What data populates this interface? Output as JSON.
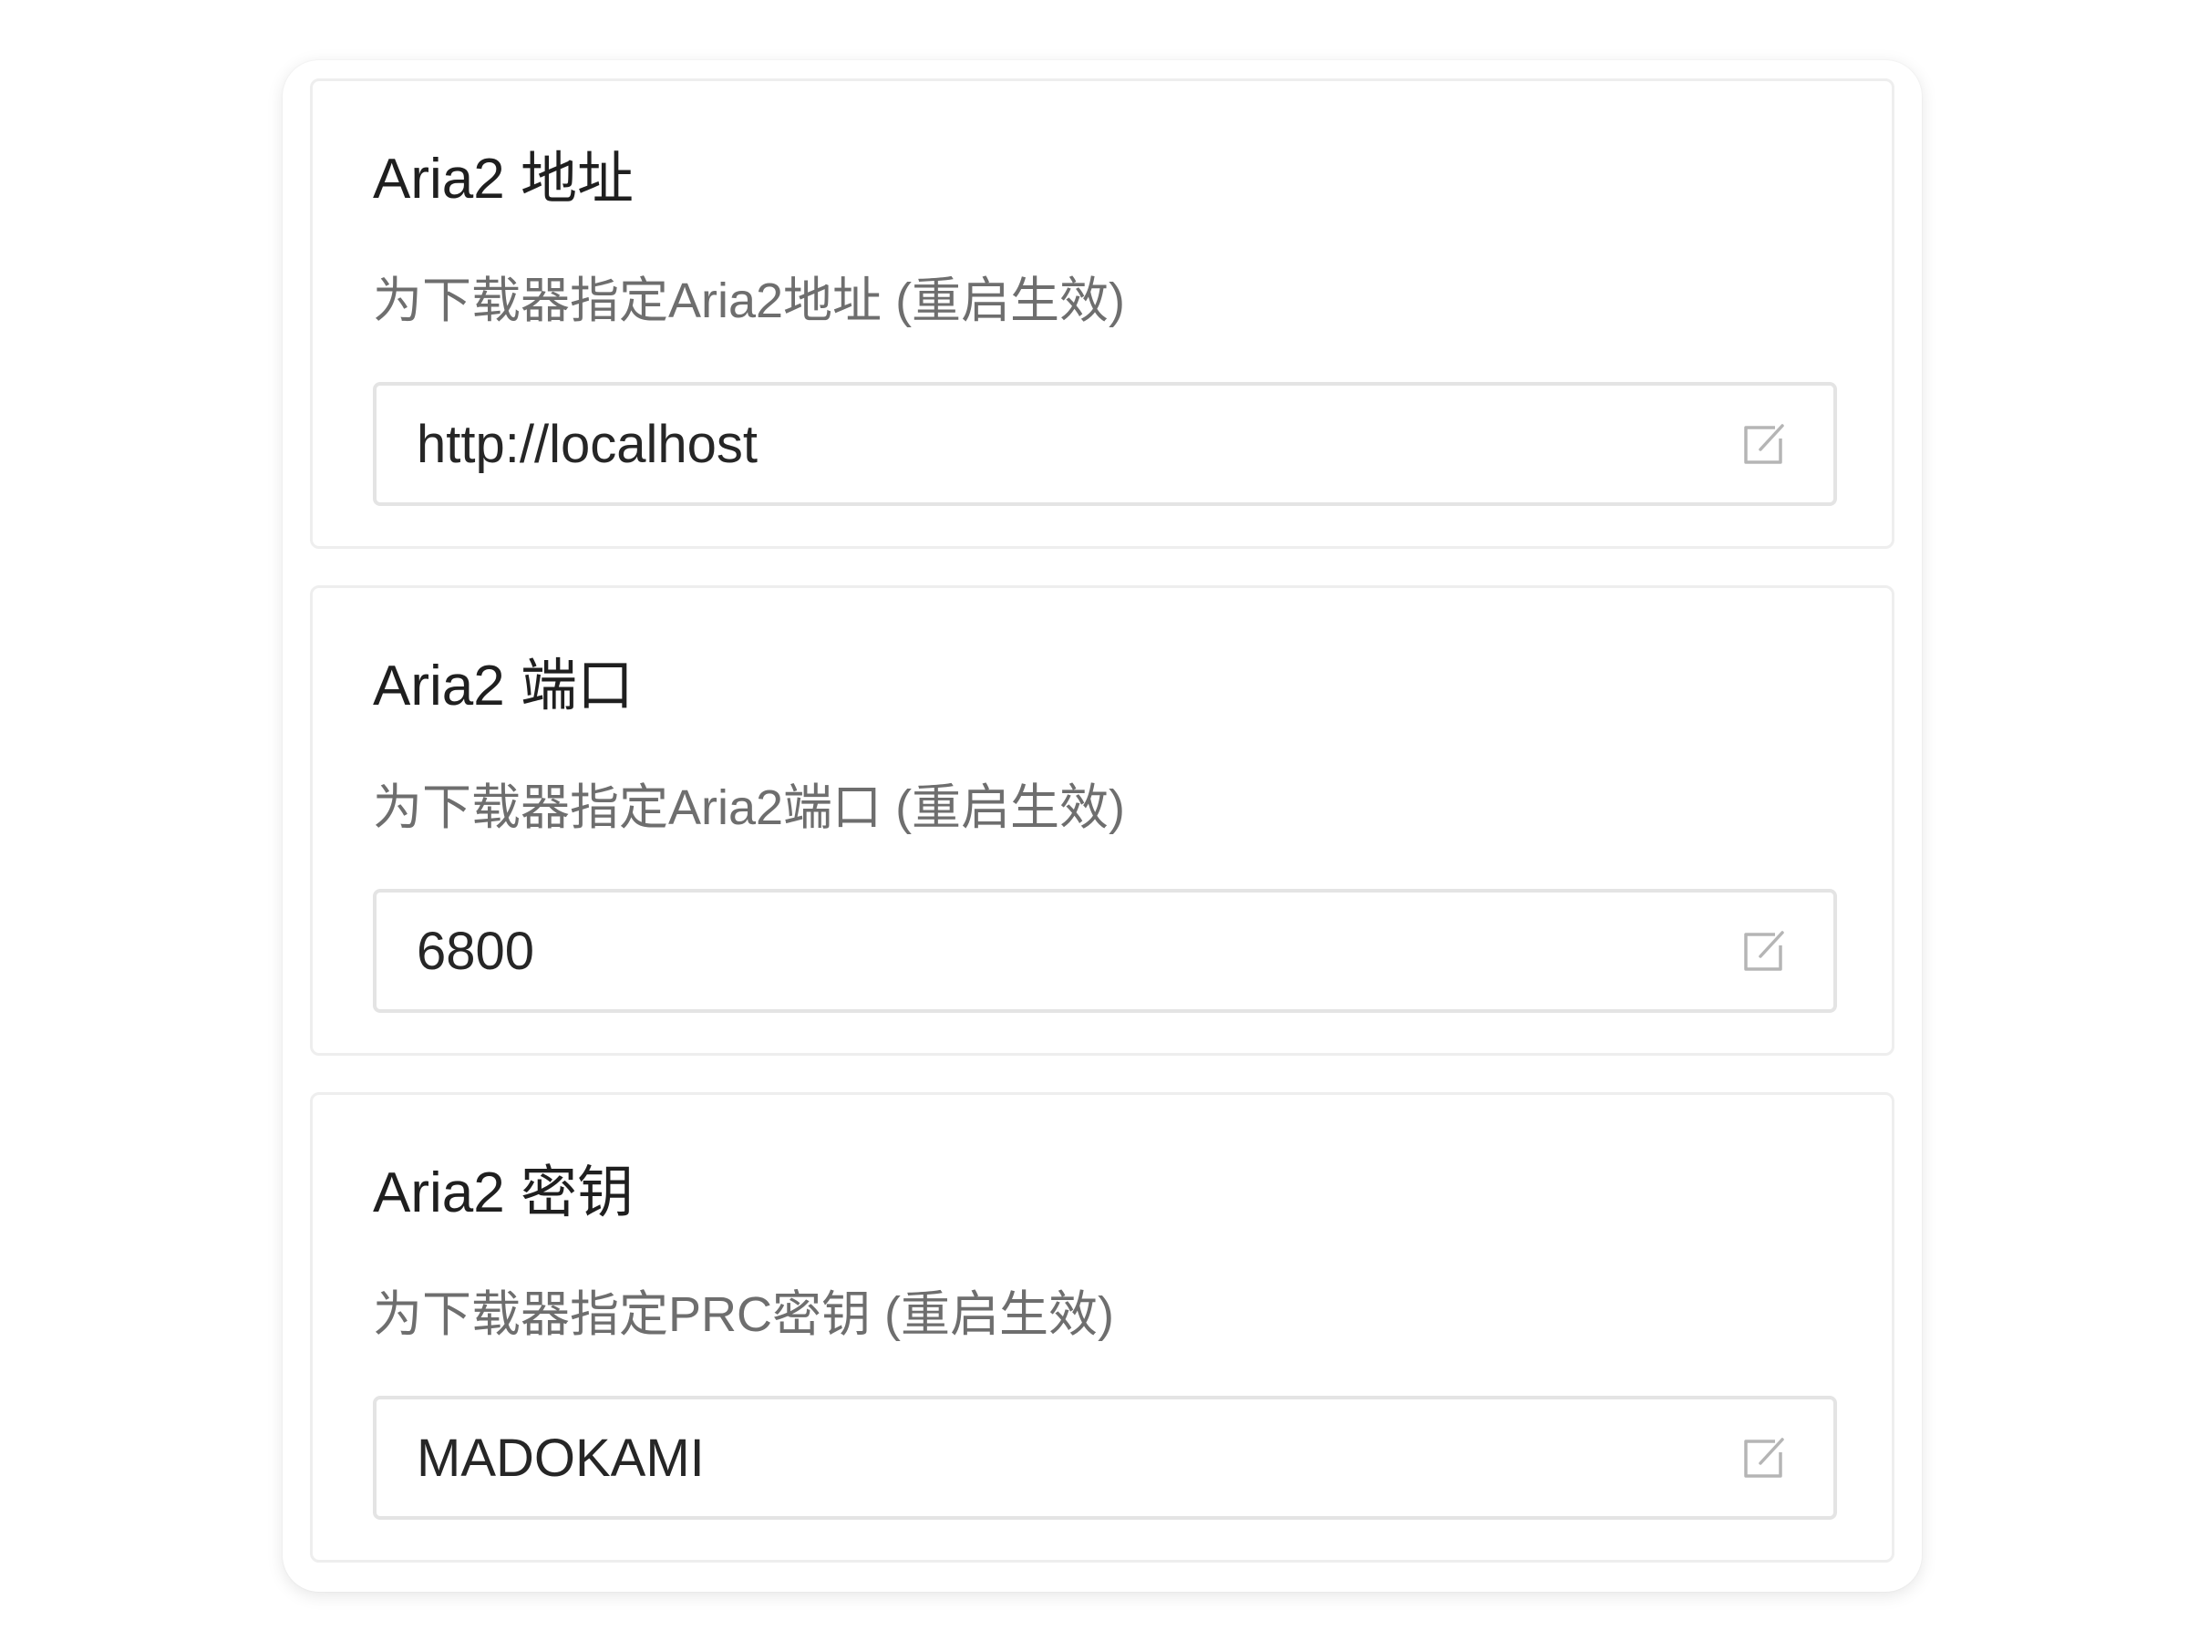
{
  "settings": [
    {
      "title": "Aria2 地址",
      "description": "为下载器指定Aria2地址 (重启生效)",
      "value": "http://localhost",
      "icon": "edit-icon"
    },
    {
      "title": "Aria2 端口",
      "description": "为下载器指定Aria2端口 (重启生效)",
      "value": "6800",
      "icon": "edit-icon"
    },
    {
      "title": "Aria2 密钥",
      "description": "为下载器指定PRC密钥 (重启生效)",
      "value": "MADOKAMI",
      "icon": "edit-icon"
    }
  ]
}
